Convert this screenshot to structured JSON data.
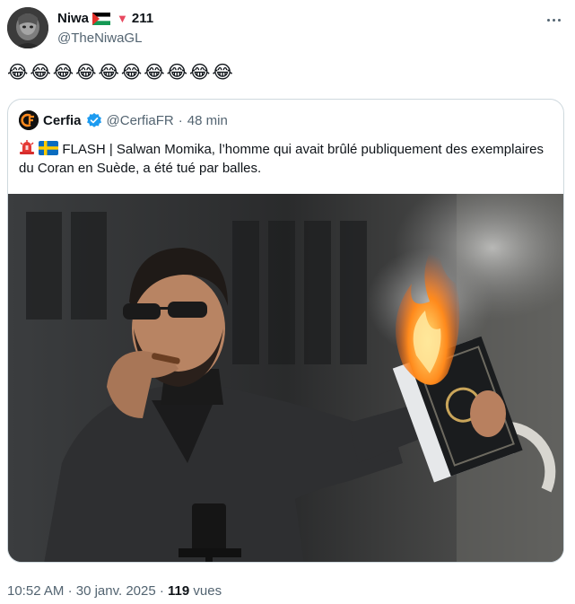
{
  "author": {
    "name": "Niwa",
    "heart_count": "211",
    "handle": "@TheNiwaGL"
  },
  "tweet": {
    "text": "😂😂😂😂😂😂😂😂😂😂"
  },
  "quoted": {
    "name": "Cerfia",
    "handle": "@CerfiaFR",
    "separator": "·",
    "time": "48 min",
    "text": "FLASH | Salwan Momika, l’homme qui avait brûlé publiquement des exemplaires du Coran en Suède, a été tué par balles.",
    "verified_color": "#1d9bf0"
  },
  "footer": {
    "time": "10:52 AM",
    "separator1": "·",
    "date": "30 janv. 2025",
    "separator2": "·",
    "views_count": "119",
    "views_label": "vues"
  },
  "colors": {
    "text_primary": "#0f1419",
    "text_secondary": "#536471",
    "border": "#cfd9de",
    "heart": "#e8485f"
  }
}
